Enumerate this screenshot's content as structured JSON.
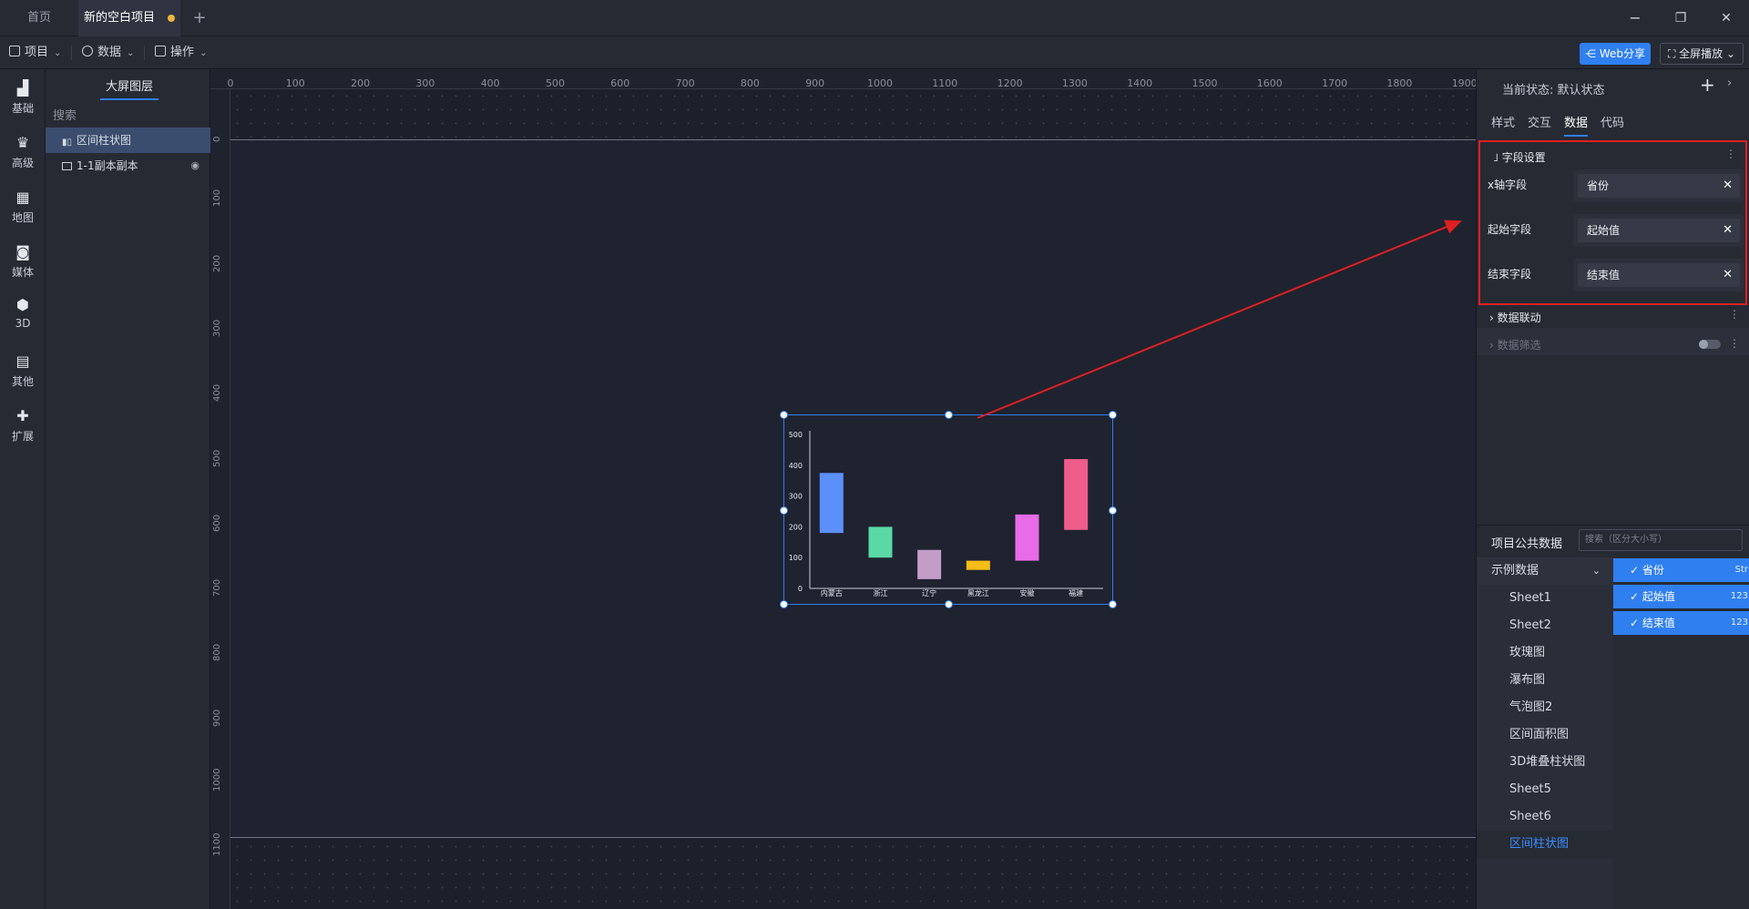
{
  "tabs": [
    {
      "label": "首页"
    },
    {
      "label": "新的空白项目",
      "modified": true
    }
  ],
  "add_tab": "+",
  "window": {
    "minimize": "−",
    "restore": "❐",
    "close": "✕"
  },
  "toolbar": {
    "project": "项目",
    "data": "数据",
    "operate": "操作",
    "share": "Web分享",
    "fullscreen": "全屏播放"
  },
  "rail": [
    "基础",
    "高级",
    "地图",
    "媒体",
    "3D",
    "其他",
    "扩展"
  ],
  "layers": {
    "title": "大屏图层",
    "search": "搜索",
    "items": [
      {
        "label": "区间柱状图",
        "selected": true
      },
      {
        "label": "1-1副本副本",
        "selected": false
      }
    ]
  },
  "ruler": {
    "top": [
      "0",
      "100",
      "200",
      "300",
      "400",
      "500",
      "600",
      "700",
      "800",
      "900",
      "1000",
      "1100",
      "1200",
      "1300",
      "1400",
      "1500",
      "1600",
      "1700",
      "1800",
      "1900"
    ],
    "left": [
      "0",
      "100",
      "200",
      "300",
      "400",
      "500",
      "600",
      "700",
      "800",
      "900",
      "1000",
      "1100"
    ]
  },
  "chart_data": {
    "type": "bar",
    "categories": [
      "内蒙古",
      "浙江",
      "辽宁",
      "黑龙江",
      "安徽",
      "福建"
    ],
    "series": [
      {
        "start": 180,
        "end": 375
      },
      {
        "start": 100,
        "end": 200
      },
      {
        "start": 30,
        "end": 125
      },
      {
        "start": 60,
        "end": 90
      },
      {
        "start": 90,
        "end": 240
      },
      {
        "start": 190,
        "end": 420
      }
    ],
    "colors": [
      "#5b8ff9",
      "#5ad8a6",
      "#c39dc8",
      "#f6bd16",
      "#e86be8",
      "#ee5d8a"
    ],
    "yticks": [
      "0",
      "100",
      "200",
      "300",
      "400",
      "500"
    ],
    "ylim": [
      0,
      500
    ]
  },
  "right_panel": {
    "state_label": "当前状态:",
    "state_value": "默认状态",
    "add": "+",
    "arrow": "›",
    "tabs": [
      "样式",
      "交互",
      "数据",
      "代码"
    ],
    "active_tab": 2,
    "field_section": "字段设置",
    "fields": [
      {
        "label": "x轴字段",
        "value": "省份"
      },
      {
        "label": "起始字段",
        "value": "起始值"
      },
      {
        "label": "结束字段",
        "value": "结束值"
      }
    ],
    "linkage": "数据联动",
    "filter": "数据筛选",
    "more": "⋮",
    "clear": "✕"
  },
  "public_data": {
    "title": "项目公共数据",
    "search_placeholder": "搜索（区分大小写）",
    "group": "示例数据",
    "items": [
      "Sheet1",
      "Sheet2",
      "玫瑰图",
      "瀑布图",
      "气泡图2",
      "区间面积图",
      "3D堆叠柱状图",
      "Sheet5",
      "Sheet6",
      "区间柱状图"
    ],
    "active_item": "区间柱状图",
    "checked_fields": [
      {
        "name": "省份",
        "type": "Str"
      },
      {
        "name": "起始值",
        "type": "123"
      },
      {
        "name": "结束值",
        "type": "123"
      }
    ]
  },
  "colors": {
    "accent": "#2f7ff0",
    "annotation": "#e02020"
  }
}
